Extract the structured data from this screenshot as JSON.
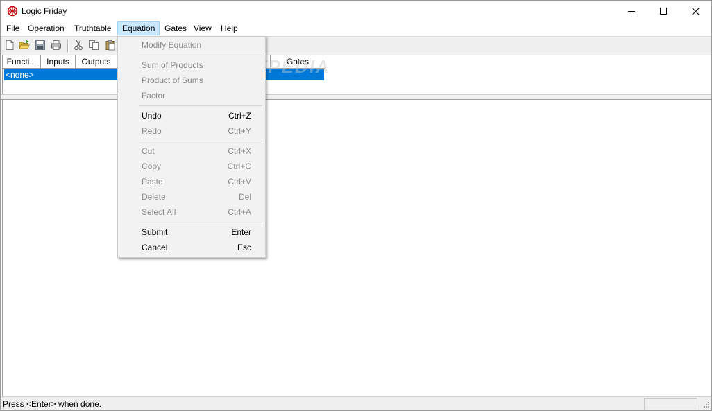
{
  "window": {
    "title": "Logic Friday"
  },
  "menubar": {
    "items": [
      "File",
      "Operation",
      "Truthtable",
      "Equation",
      "Gates",
      "View",
      "Help"
    ],
    "active": "Equation"
  },
  "toolbar": {
    "icons": [
      "new-file-icon",
      "open-folder-icon",
      "save-icon",
      "print-icon",
      "cut-icon",
      "copy-icon",
      "paste-icon"
    ]
  },
  "table": {
    "columns": [
      "Functi...",
      "Inputs",
      "Outputs",
      "Gates"
    ],
    "rows": [
      "<none>"
    ]
  },
  "watermark": "SOFTPEDIA",
  "dropdown": {
    "items": [
      {
        "label": "Modify Equation",
        "shortcut": "",
        "enabled": false
      },
      {
        "label": "Sum of Products",
        "shortcut": "",
        "enabled": false
      },
      {
        "label": "Product of Sums",
        "shortcut": "",
        "enabled": false
      },
      {
        "label": "Factor",
        "shortcut": "",
        "enabled": false
      },
      {
        "label": "Undo",
        "shortcut": "Ctrl+Z",
        "enabled": true
      },
      {
        "label": "Redo",
        "shortcut": "Ctrl+Y",
        "enabled": false
      },
      {
        "label": "Cut",
        "shortcut": "Ctrl+X",
        "enabled": false
      },
      {
        "label": "Copy",
        "shortcut": "Ctrl+C",
        "enabled": false
      },
      {
        "label": "Paste",
        "shortcut": "Ctrl+V",
        "enabled": false
      },
      {
        "label": "Delete",
        "shortcut": "Del",
        "enabled": false
      },
      {
        "label": "Select All",
        "shortcut": "Ctrl+A",
        "enabled": false
      },
      {
        "label": "Submit",
        "shortcut": "Enter",
        "enabled": true
      },
      {
        "label": "Cancel",
        "shortcut": "Esc",
        "enabled": true
      }
    ]
  },
  "statusbar": {
    "text": "Press <Enter> when done."
  },
  "colors": {
    "selection": "#0078d7",
    "menu_active_bg": "#cce8ff",
    "disabled_text": "#8c8c8c"
  }
}
